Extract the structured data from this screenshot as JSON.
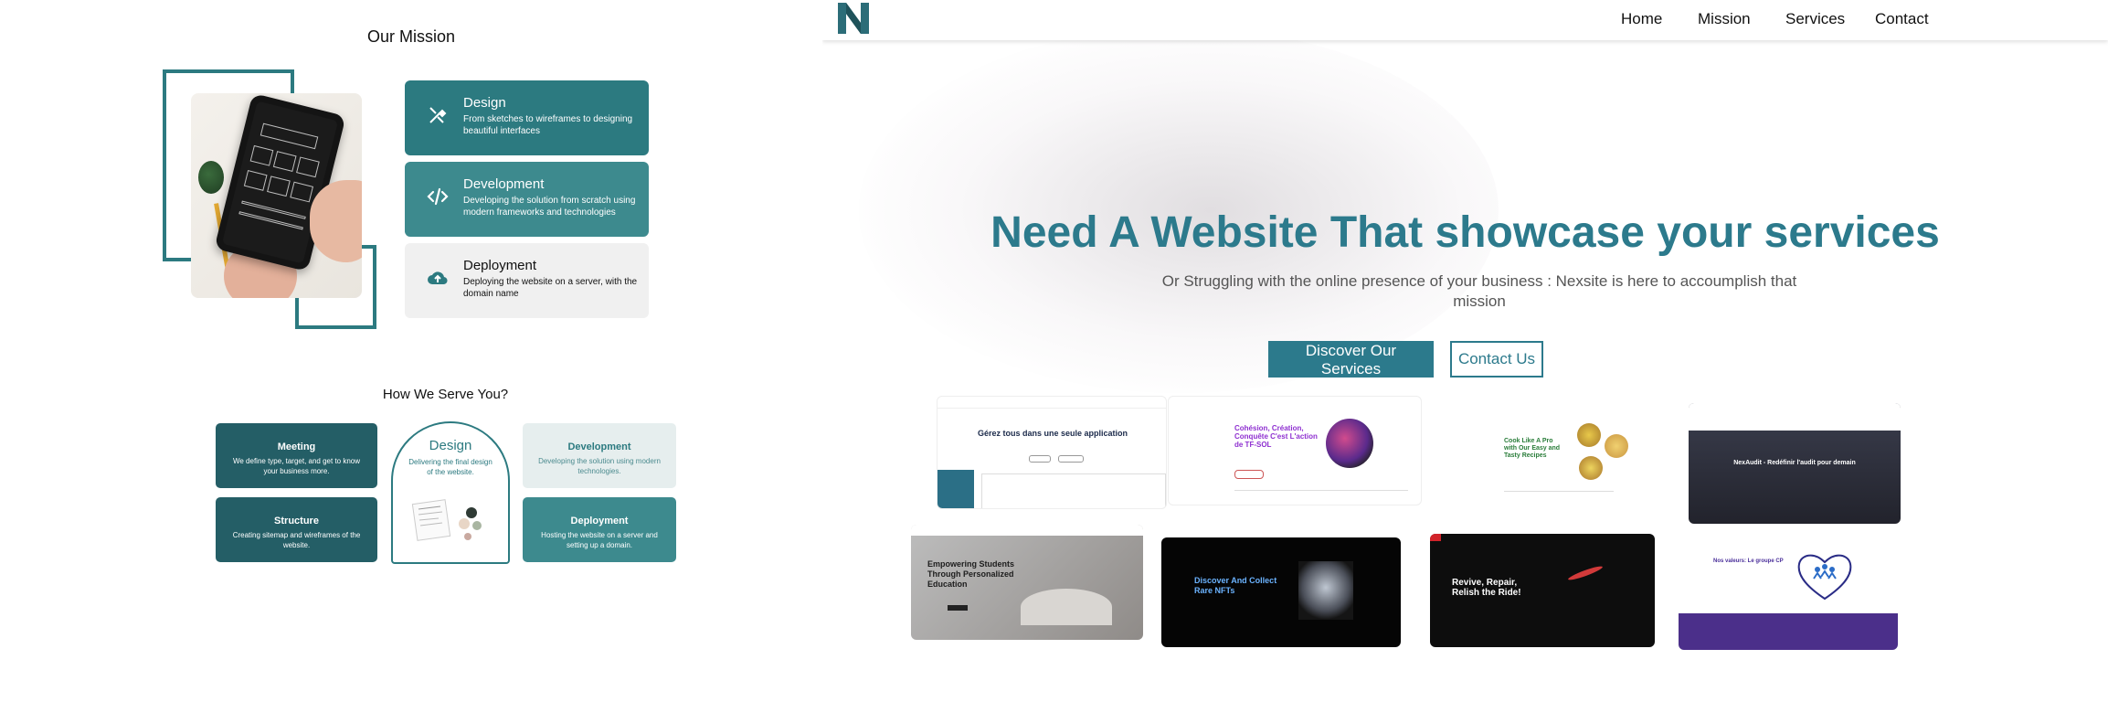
{
  "mission": {
    "title": "Our Mission",
    "cards": [
      {
        "title": "Design",
        "desc": "From sketches to wireframes to designing beautiful interfaces",
        "icon": "design-tools-icon"
      },
      {
        "title": "Development",
        "desc": "Developing the solution from scratch using modern frameworks and technologies",
        "icon": "code-icon"
      },
      {
        "title": "Deployment",
        "desc": "Deploying the website on a server, with the domain name",
        "icon": "cloud-upload-icon"
      }
    ]
  },
  "serve": {
    "title": "How We Serve You?",
    "meeting": {
      "title": "Meeting",
      "desc": "We define type, target, and get to know your business more."
    },
    "structure": {
      "title": "Structure",
      "desc": "Creating sitemap and wireframes of the website."
    },
    "design": {
      "title": "Design",
      "desc": "Delivering the final design of the website."
    },
    "development": {
      "title": "Development",
      "desc": "Developing the solution using modern technologies."
    },
    "deployment": {
      "title": "Deployment",
      "desc": "Hosting the website on a server and setting up a domain."
    }
  },
  "nav": {
    "logo": "N",
    "links": [
      "Home",
      "Mission",
      "Services",
      "Contact"
    ]
  },
  "hero": {
    "title": "Need A Website That showcase your services",
    "subtitle": "Or Struggling with the online presence of your business : Nexsite is here to accoumplish that mission",
    "primary_button": "Discover Our Services",
    "secondary_button": "Contact Us"
  },
  "portfolio": {
    "th1": "Gérez tous dans une seule application",
    "th2": "Cohésion, Création, Conquête C'est L'action de TF-SOL",
    "th3": "Cook Like A Pro with Our Easy and Tasty Recipes",
    "th4": "NexAudit - Redéfinir l'audit pour demain",
    "th5": "Empowering Students Through Personalized Education",
    "th6": "Discover And Collect Rare NFTs",
    "th7": "Revive, Repair, Relish the Ride!",
    "th8": "Nos valeurs: Le groupe CP"
  },
  "colors": {
    "primary": "#2c7a8c",
    "mission_card": "#2c7a80",
    "serve_dark": "#245e66"
  }
}
